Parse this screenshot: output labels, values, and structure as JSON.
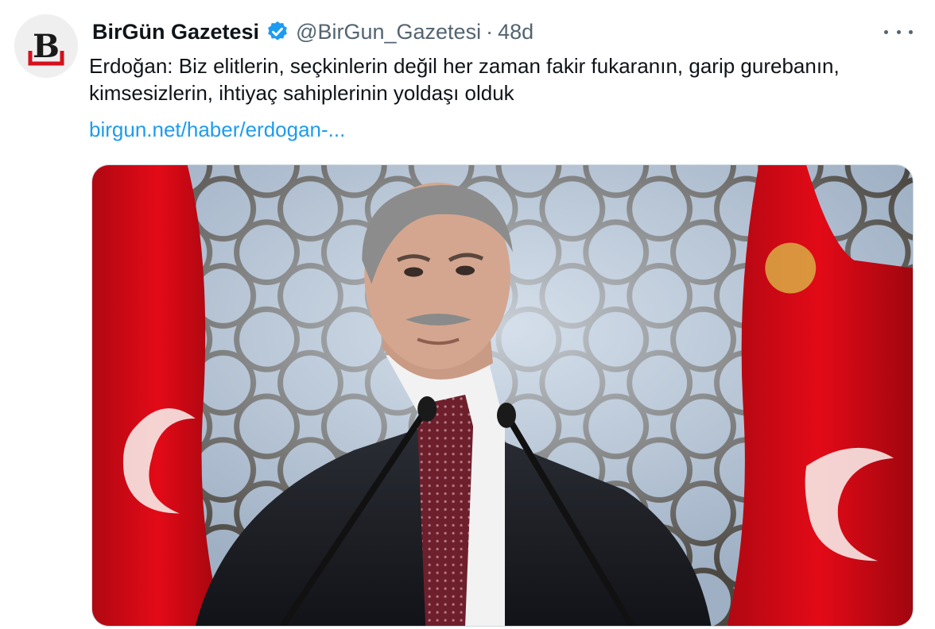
{
  "tweet": {
    "display_name": "BirGün Gazetesi",
    "verified_icon": "verified-badge-icon",
    "handle": "@BirGun_Gazetesi",
    "separator": "·",
    "time": "48d",
    "text": "Erdoğan: Biz elitlerin, seçkinlerin değil her zaman fakir fukaranın, garip gurebanın, kimsesizlerin, ihtiyaç sahiplerinin yoldaşı olduk",
    "link": "birgun.net/haber/erdogan-...",
    "more_icon": "more-options-icon",
    "avatar_letter": "B"
  },
  "colors": {
    "link": "#1d9bf0",
    "verified": "#1d9bf0",
    "secondary_text": "#536471",
    "logo_red": "#d4111d",
    "flag_red": "#e30a17"
  }
}
